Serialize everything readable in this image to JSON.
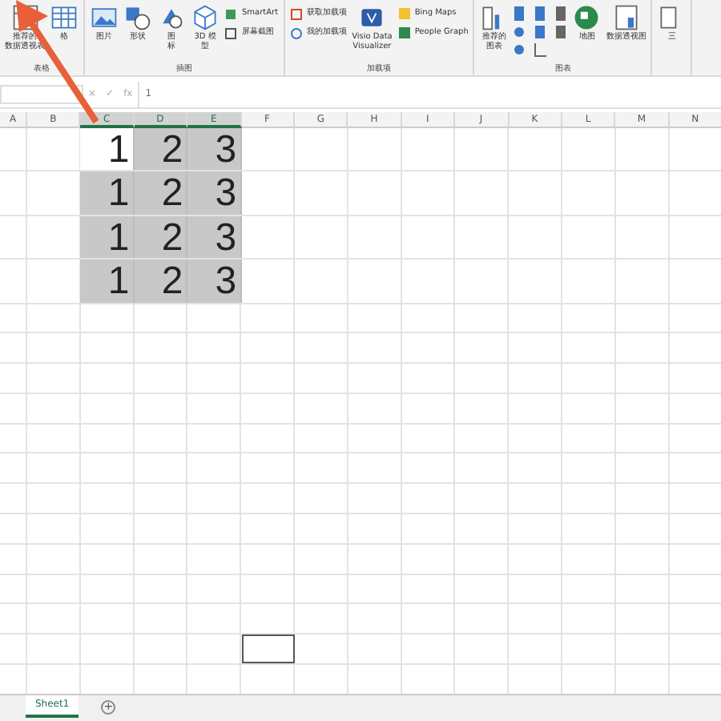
{
  "ribbon": {
    "groups": [
      {
        "label": "表格",
        "items": [
          {
            "kind": "large",
            "lines": [
              "推荐的",
              "数据透视表"
            ]
          },
          {
            "kind": "large",
            "lines": [
              "格"
            ]
          }
        ]
      },
      {
        "label": "插图",
        "items": [
          {
            "kind": "large",
            "lines": [
              "图片"
            ]
          },
          {
            "kind": "large",
            "lines": [
              "形状"
            ]
          },
          {
            "kind": "large",
            "lines": [
              "图",
              "标"
            ]
          },
          {
            "kind": "large",
            "lines": [
              "3D 模",
              "型"
            ]
          },
          {
            "kind": "small",
            "lines": [
              "SmartArt"
            ]
          },
          {
            "kind": "small",
            "lines": [
              "屏幕截图"
            ]
          }
        ]
      },
      {
        "label": "加载项",
        "items": [
          {
            "kind": "small",
            "lines": [
              "获取加载项"
            ]
          },
          {
            "kind": "small",
            "lines": [
              "我的加载项"
            ]
          },
          {
            "kind": "large",
            "lines": [
              "Visio Data",
              "Visualizer"
            ]
          },
          {
            "kind": "small",
            "lines": [
              "Bing Maps"
            ]
          },
          {
            "kind": "small",
            "lines": [
              "People Graph"
            ]
          }
        ]
      },
      {
        "label": "图表",
        "items": [
          {
            "kind": "large",
            "lines": [
              "推荐的",
              "图表"
            ]
          },
          {
            "kind": "grid"
          },
          {
            "kind": "large",
            "lines": [
              "地图"
            ]
          },
          {
            "kind": "large",
            "lines": [
              "数据透视图"
            ]
          }
        ]
      },
      {
        "items": [
          {
            "kind": "large",
            "lines": [
              "三"
            ]
          }
        ]
      }
    ]
  },
  "formula_bar": {
    "cancel": "×",
    "enter": "✓",
    "fx": "fx",
    "value": "1"
  },
  "columns": [
    "A",
    "B",
    "C",
    "D",
    "E",
    "F",
    "G",
    "H",
    "I",
    "J",
    "K",
    "L",
    "M",
    "N"
  ],
  "rows": [
    {
      "kind": "data",
      "cells": [
        {
          "value": "1",
          "active": true
        },
        {
          "value": "2",
          "active": false
        },
        {
          "value": "3",
          "active": false
        }
      ]
    },
    {
      "kind": "data",
      "cells": [
        {
          "value": "1",
          "active": false
        },
        {
          "value": "2",
          "active": false
        },
        {
          "value": "3",
          "active": false
        }
      ]
    },
    {
      "kind": "data",
      "cells": [
        {
          "value": "1",
          "active": false
        },
        {
          "value": "2",
          "active": false
        },
        {
          "value": "3",
          "active": false
        }
      ]
    },
    {
      "kind": "data",
      "cells": [
        {
          "value": "1",
          "active": false
        },
        {
          "value": "2",
          "active": false
        },
        {
          "value": "3",
          "active": false
        }
      ]
    },
    {
      "kind": "empty",
      "outlined": false
    },
    {
      "kind": "empty",
      "outlined": false
    },
    {
      "kind": "empty",
      "outlined": false
    },
    {
      "kind": "empty",
      "outlined": false
    },
    {
      "kind": "empty",
      "outlined": false
    },
    {
      "kind": "empty",
      "outlined": false
    },
    {
      "kind": "empty",
      "outlined": false
    },
    {
      "kind": "empty",
      "outlined": false
    },
    {
      "kind": "empty",
      "outlined": false
    },
    {
      "kind": "empty",
      "outlined": false
    },
    {
      "kind": "empty",
      "outlined": false
    },
    {
      "kind": "empty",
      "outlined": true
    },
    {
      "kind": "empty",
      "outlined": false
    }
  ],
  "sheet_tabs": [
    {
      "label": "Sheet1",
      "selected": true
    }
  ],
  "add_sheet": "+"
}
